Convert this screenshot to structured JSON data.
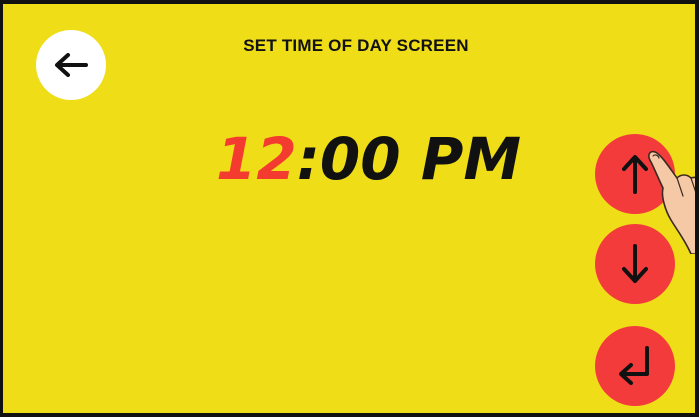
{
  "title": "SET TIME OF DAY SCREEN",
  "time": {
    "hour": "12",
    "rest": ":00 PM"
  },
  "icons": {
    "back": "arrow-left-icon",
    "up": "arrow-up-icon",
    "down": "arrow-down-icon",
    "enter": "enter-return-icon",
    "pointer": "pointing-hand-icon"
  },
  "colors": {
    "background": "#efdd18",
    "hour_accent": "#f43b2f",
    "button": "#f43b3b",
    "back_button": "#ffffff",
    "text": "#111111"
  }
}
